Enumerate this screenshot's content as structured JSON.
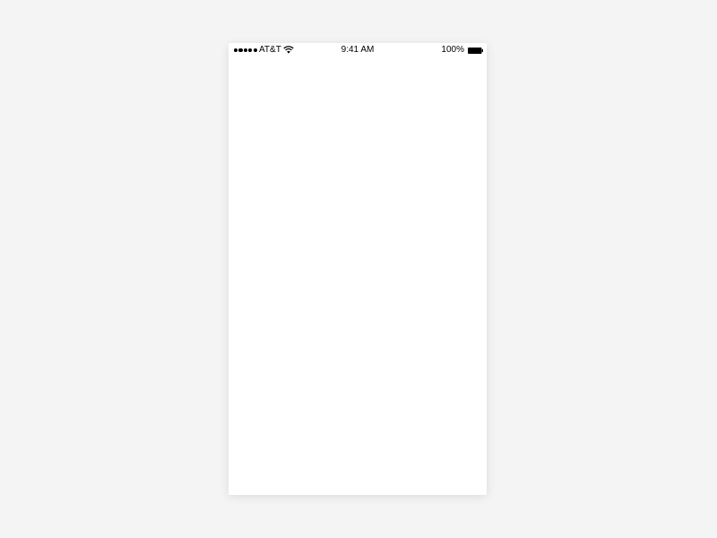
{
  "status_bar": {
    "carrier": "AT&T",
    "time": "9:41 AM",
    "battery_percent": "100%",
    "signal_bars": 5,
    "icons": {
      "signal": "signal-dots-icon",
      "wifi": "wifi-icon",
      "battery": "battery-icon"
    }
  },
  "colors": {
    "background": "#f4f4f4",
    "screen": "#ffffff",
    "status_text": "#000000"
  }
}
